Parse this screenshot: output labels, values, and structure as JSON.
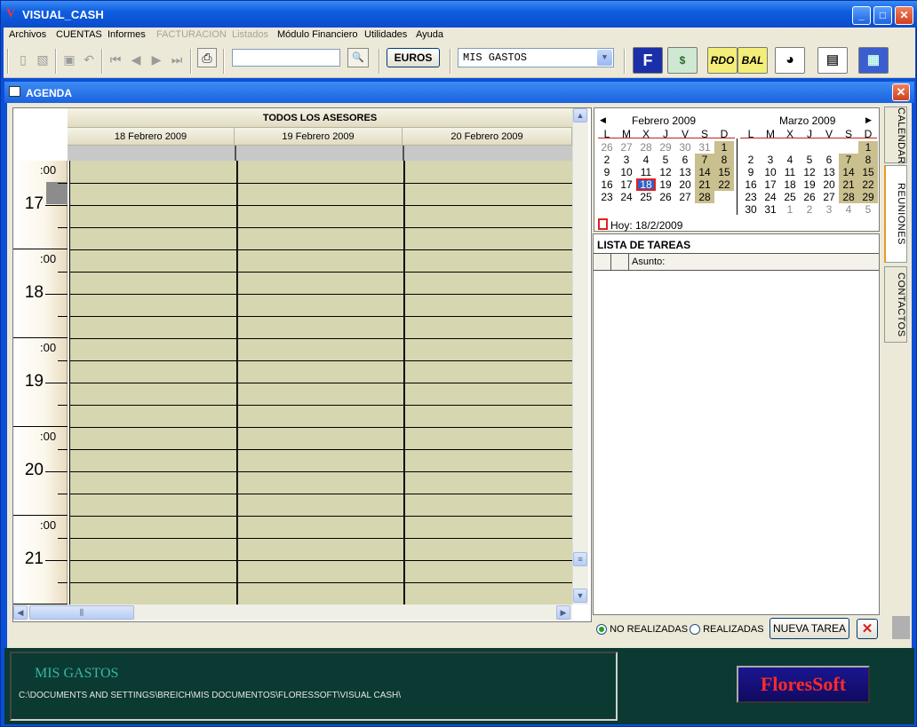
{
  "window": {
    "title": "VISUAL_CASH"
  },
  "menu": {
    "items": [
      {
        "label": "Archivos",
        "disabled": false
      },
      {
        "label": "CUENTAS",
        "disabled": false
      },
      {
        "label": "Informes",
        "disabled": false
      },
      {
        "label": "FACTURACION",
        "disabled": true
      },
      {
        "label": "Listados",
        "disabled": true
      },
      {
        "label": "Módulo Financiero",
        "disabled": false
      },
      {
        "label": "Utilidades",
        "disabled": false
      },
      {
        "label": "Ayuda",
        "disabled": false
      }
    ]
  },
  "toolbar": {
    "search_value": "",
    "euros_label": "EUROS",
    "account_selected": "MIS GASTOS",
    "buttons": {
      "f_icon": "F",
      "rdo": "RDO",
      "bal": "BAL"
    }
  },
  "agenda": {
    "title": "AGENDA",
    "advisors_label": "TODOS LOS ASESORES",
    "days": [
      "18 Febrero 2009",
      "19 Febrero 2009",
      "20 Febrero 2009"
    ],
    "hours": [
      "17",
      "18",
      "19",
      "20",
      "21"
    ],
    "minute_label": ":00"
  },
  "calendar": {
    "months": [
      {
        "name": "Febrero 2009",
        "dow": [
          "L",
          "M",
          "X",
          "J",
          "V",
          "S",
          "D"
        ],
        "weeks": [
          [
            {
              "d": "26",
              "o": 1
            },
            {
              "d": "27",
              "o": 1
            },
            {
              "d": "28",
              "o": 1
            },
            {
              "d": "29",
              "o": 1
            },
            {
              "d": "30",
              "o": 1
            },
            {
              "d": "31",
              "o": 1
            },
            {
              "d": "1",
              "h": 1
            }
          ],
          [
            {
              "d": "2"
            },
            {
              "d": "3"
            },
            {
              "d": "4"
            },
            {
              "d": "5"
            },
            {
              "d": "6"
            },
            {
              "d": "7",
              "h": 1
            },
            {
              "d": "8",
              "h": 1
            }
          ],
          [
            {
              "d": "9"
            },
            {
              "d": "10"
            },
            {
              "d": "11"
            },
            {
              "d": "12"
            },
            {
              "d": "13"
            },
            {
              "d": "14",
              "h": 1
            },
            {
              "d": "15",
              "h": 1
            }
          ],
          [
            {
              "d": "16"
            },
            {
              "d": "17"
            },
            {
              "d": "18",
              "t": 1
            },
            {
              "d": "19"
            },
            {
              "d": "20"
            },
            {
              "d": "21",
              "h": 1
            },
            {
              "d": "22",
              "h": 1
            }
          ],
          [
            {
              "d": "23"
            },
            {
              "d": "24"
            },
            {
              "d": "25"
            },
            {
              "d": "26"
            },
            {
              "d": "27"
            },
            {
              "d": "28",
              "h": 1
            },
            {
              "d": ""
            }
          ]
        ]
      },
      {
        "name": "Marzo 2009",
        "dow": [
          "L",
          "M",
          "X",
          "J",
          "V",
          "S",
          "D"
        ],
        "weeks": [
          [
            {
              "d": ""
            },
            {
              "d": ""
            },
            {
              "d": ""
            },
            {
              "d": ""
            },
            {
              "d": ""
            },
            {
              "d": ""
            },
            {
              "d": "1",
              "h": 1
            }
          ],
          [
            {
              "d": "2"
            },
            {
              "d": "3"
            },
            {
              "d": "4"
            },
            {
              "d": "5"
            },
            {
              "d": "6"
            },
            {
              "d": "7",
              "h": 1
            },
            {
              "d": "8",
              "h": 1
            }
          ],
          [
            {
              "d": "9"
            },
            {
              "d": "10"
            },
            {
              "d": "11"
            },
            {
              "d": "12"
            },
            {
              "d": "13"
            },
            {
              "d": "14",
              "h": 1
            },
            {
              "d": "15",
              "h": 1
            }
          ],
          [
            {
              "d": "16"
            },
            {
              "d": "17"
            },
            {
              "d": "18"
            },
            {
              "d": "19"
            },
            {
              "d": "20"
            },
            {
              "d": "21",
              "h": 1
            },
            {
              "d": "22",
              "h": 1
            }
          ],
          [
            {
              "d": "23"
            },
            {
              "d": "24"
            },
            {
              "d": "25"
            },
            {
              "d": "26"
            },
            {
              "d": "27"
            },
            {
              "d": "28",
              "h": 1
            },
            {
              "d": "29",
              "h": 1
            }
          ],
          [
            {
              "d": "30"
            },
            {
              "d": "31"
            },
            {
              "d": "1",
              "o": 1
            },
            {
              "d": "2",
              "o": 1
            },
            {
              "d": "3",
              "o": 1
            },
            {
              "d": "4",
              "o": 1
            },
            {
              "d": "5",
              "o": 1
            }
          ]
        ]
      }
    ],
    "today_label": "Hoy: 18/2/2009"
  },
  "tasks": {
    "title": "LISTA DE TAREAS",
    "column_subject": "Asunto:",
    "filter_pending": "NO REALIZADAS",
    "filter_done": "REALIZADAS",
    "new_task": "NUEVA TAREA"
  },
  "tabs": [
    "CALENDARIO",
    "REUNIONES",
    "CONTACTOS"
  ],
  "status": {
    "account": "MIS GASTOS",
    "path": "C:\\DOCUMENTS AND SETTINGS\\BREICH\\MIS DOCUMENTOS\\FLORESSOFT\\VISUAL CASH\\",
    "brand": "FloresSoft"
  },
  "colors": {
    "grid": "#d6d6b0",
    "weekend": "#c9bf8f",
    "status_bg": "#0b3a32",
    "accent": "#0a4fd6"
  }
}
